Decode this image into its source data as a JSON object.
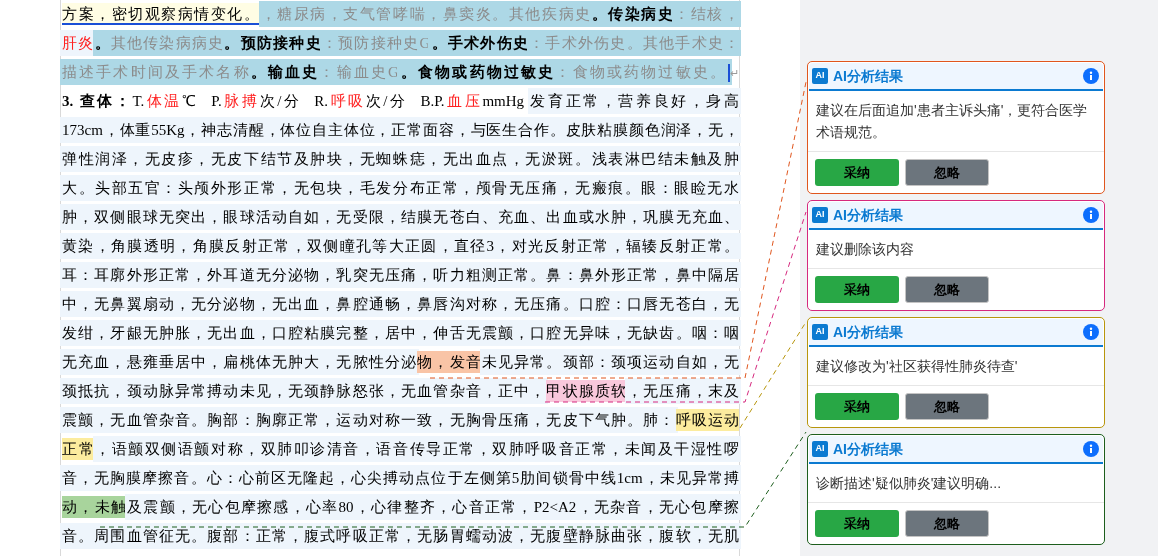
{
  "document": {
    "lines": [
      {
        "segments": [
          {
            "text": "方案，密切观察病情变化。",
            "kind": "plain",
            "selected": false,
            "shaded": false,
            "underlined": true,
            "color": "#fffde4"
          },
          {
            "text": "，糖尿病，支气管哮喘，鼻窦炎。其他疾病史",
            "kind": "field",
            "selected": true,
            "shaded": false,
            "underlined": false
          },
          {
            "text": "。传染病史",
            "kind": "bold",
            "selected": true,
            "shaded": false,
            "underlined": false
          },
          {
            "text": "：结核，",
            "kind": "field",
            "selected": true,
            "shaded": false,
            "underlined": false
          }
        ]
      },
      {
        "segments": [
          {
            "text": "肝炎",
            "kind": "value",
            "selected": false,
            "shaded": true,
            "underlined": false
          },
          {
            "text": "。",
            "kind": "bold",
            "selected": true,
            "shaded": false,
            "underlined": false
          },
          {
            "text": "其他传染病病史",
            "kind": "field",
            "selected": true,
            "shaded": false,
            "underlined": false
          },
          {
            "text": "。预防接种史",
            "kind": "bold",
            "selected": true,
            "shaded": false,
            "underlined": false
          },
          {
            "text": "：预防接种史G",
            "kind": "field",
            "selected": true,
            "shaded": false,
            "underlined": false
          },
          {
            "text": "。手术外伤史",
            "kind": "bold",
            "selected": true,
            "shaded": false,
            "underlined": false
          },
          {
            "text": "：手术外伤史。其他手术史：",
            "kind": "field",
            "selected": true,
            "shaded": false,
            "underlined": false
          }
        ]
      },
      {
        "cursor": true,
        "segments": [
          {
            "text": "描述手术时间及手术名称",
            "kind": "field",
            "selected": true,
            "shaded": false,
            "underlined": false
          },
          {
            "text": "。输血史",
            "kind": "bold",
            "selected": true,
            "shaded": false,
            "underlined": false
          },
          {
            "text": "：输血史G",
            "kind": "field",
            "selected": true,
            "shaded": false,
            "underlined": false
          },
          {
            "text": "。食物或药物过敏史",
            "kind": "bold",
            "selected": true,
            "shaded": false,
            "underlined": false
          },
          {
            "text": "：食物或药物过敏史。",
            "kind": "field",
            "selected": true,
            "shaded": false,
            "underlined": false
          },
          {
            "text": "↵",
            "kind": "pilcrow",
            "selected": false,
            "shaded": false,
            "underlined": false
          }
        ]
      },
      {
        "segments": [
          {
            "text": "3. 查体：",
            "kind": "bold",
            "selected": false,
            "shaded": false,
            "underlined": false
          },
          {
            "text": "T.",
            "kind": "plain",
            "selected": false,
            "shaded": false,
            "underlined": false
          },
          {
            "text": "体温",
            "kind": "value",
            "selected": false,
            "shaded": false,
            "underlined": false
          },
          {
            "text": "℃  P.",
            "kind": "plain",
            "selected": false,
            "shaded": false,
            "underlined": false
          },
          {
            "text": "脉搏",
            "kind": "value",
            "selected": false,
            "shaded": false,
            "underlined": false
          },
          {
            "text": "次/分  R.",
            "kind": "plain",
            "selected": false,
            "shaded": false,
            "underlined": false
          },
          {
            "text": "呼吸",
            "kind": "value",
            "selected": false,
            "shaded": false,
            "underlined": false
          },
          {
            "text": "次/分  B.P.",
            "kind": "plain",
            "selected": false,
            "shaded": false,
            "underlined": false
          },
          {
            "text": "血压",
            "kind": "value",
            "selected": false,
            "shaded": false,
            "underlined": false
          },
          {
            "text": "mmHg ",
            "kind": "plain",
            "selected": false,
            "shaded": false,
            "underlined": false
          },
          {
            "text": "发育正常，营养良好，身高",
            "kind": "plain",
            "selected": false,
            "shaded": true,
            "underlined": false
          }
        ]
      },
      {
        "segments": [
          {
            "text": "173cm，体重55Kg，神志清醒，体位自主体位，正常面容，与医生合作。皮肤粘膜颜色润泽，无，",
            "kind": "plain",
            "selected": false,
            "shaded": true,
            "underlined": false
          }
        ]
      },
      {
        "segments": [
          {
            "text": "弹性润泽，无皮疹，无皮下结节及肿块，无蜘蛛痣，无出血点，无淤斑。浅表淋巴结未触及肿",
            "kind": "plain",
            "selected": false,
            "shaded": true,
            "underlined": false
          }
        ]
      },
      {
        "segments": [
          {
            "text": "大。头部五官：头颅外形正常，无包块，毛发分布正常，颅骨无压痛，无瘢痕。眼：眼睑无水",
            "kind": "plain",
            "selected": false,
            "shaded": true,
            "underlined": false
          }
        ]
      },
      {
        "segments": [
          {
            "text": "肿，双侧眼球无突出，眼球活动自如，无受限，结膜无苍白、充血、出血或水肿，巩膜无充血、",
            "kind": "plain",
            "selected": false,
            "shaded": true,
            "underlined": false
          }
        ]
      },
      {
        "segments": [
          {
            "text": "黄染，角膜透明，角膜反射正常，双侧瞳孔等大正圆，直径3，对光反射正常，辐辏反射正常。",
            "kind": "plain",
            "selected": false,
            "shaded": true,
            "underlined": false
          }
        ]
      },
      {
        "segments": [
          {
            "text": "耳：耳廓外形正常，外耳道无分泌物，乳突无压痛，听力粗测正常。鼻：鼻外形正常，鼻中隔居",
            "kind": "plain",
            "selected": false,
            "shaded": true,
            "underlined": false
          }
        ]
      },
      {
        "segments": [
          {
            "text": "中，无鼻翼扇动，无分泌物，无出血，鼻腔通畅，鼻唇沟对称，无压痛。口腔：口唇无苍白，无",
            "kind": "plain",
            "selected": false,
            "shaded": true,
            "underlined": false
          }
        ]
      },
      {
        "segments": [
          {
            "text": "发绀，牙龈无肿胀，无出血，口腔粘膜完整，居中，伸舌无震颤，口腔无异味，无缺齿。咽：咽",
            "kind": "plain",
            "selected": false,
            "shaded": true,
            "underlined": false
          }
        ]
      },
      {
        "segments": [
          {
            "text": "无充血，悬雍垂居中，扁桃体无肿大，无脓性分泌",
            "kind": "plain",
            "selected": false,
            "shaded": true,
            "underlined": false
          },
          {
            "text": "物，发音",
            "kind": "plain",
            "selected": false,
            "shaded": false,
            "underlined": false,
            "color": "#f9c4a6"
          },
          {
            "text": "未见异常。颈部：颈项运动自如，无",
            "kind": "plain",
            "selected": false,
            "shaded": true,
            "underlined": false
          }
        ]
      },
      {
        "segments": [
          {
            "text": "颈抵抗，颈动脉异常搏动未见，无颈静脉怒张，无血管杂音，正中，",
            "kind": "plain",
            "selected": false,
            "shaded": true,
            "underlined": false
          },
          {
            "text": "甲状腺质软",
            "kind": "plain",
            "selected": false,
            "shaded": false,
            "underlined": false,
            "color": "#f9c8dc"
          },
          {
            "text": "，无压痛，末及",
            "kind": "plain",
            "selected": false,
            "shaded": true,
            "underlined": false
          }
        ]
      },
      {
        "segments": [
          {
            "text": "震颤，无血管杂音。胸部：胸廓正常，运动对称一致，无胸骨压痛，无皮下气肿。肺：",
            "kind": "plain",
            "selected": false,
            "shaded": true,
            "underlined": false
          },
          {
            "text": "呼吸运动",
            "kind": "plain",
            "selected": false,
            "shaded": false,
            "underlined": false,
            "color": "#fcec9e"
          }
        ]
      },
      {
        "segments": [
          {
            "text": "正常",
            "kind": "plain",
            "selected": false,
            "shaded": false,
            "underlined": false,
            "color": "#fcec9e"
          },
          {
            "text": "，语颤双侧语颤对称，双肺叩诊清音，语音传导正常，双肺呼吸音正常，未闻及干湿性啰",
            "kind": "plain",
            "selected": false,
            "shaded": true,
            "underlined": false
          }
        ]
      },
      {
        "segments": [
          {
            "text": "音，无胸膜摩擦音。心：心前区无隆起，心尖搏动点位于左侧第5肋间锁骨中线1cm，未见异常搏",
            "kind": "plain",
            "selected": false,
            "shaded": true,
            "underlined": false
          }
        ]
      },
      {
        "segments": [
          {
            "text": "动，未触",
            "kind": "plain",
            "selected": false,
            "shaded": false,
            "underlined": false,
            "color": "#a8d49c"
          },
          {
            "text": "及震颤，无心包摩擦感，心率80，心律整齐，心音正常，P2<A2，无杂音，无心包摩擦",
            "kind": "plain",
            "selected": false,
            "shaded": true,
            "underlined": false
          }
        ]
      },
      {
        "segments": [
          {
            "text": "音。周围血管征无。腹部：正常，腹式呼吸正常，无肠胃蠕动波，无腹壁静脉曲张，腹软，无肌",
            "kind": "plain",
            "selected": false,
            "shaded": true,
            "underlined": false
          }
        ]
      }
    ]
  },
  "suggestions": [
    {
      "color": "#e0561e",
      "badge": "AI",
      "title": "AI分析结果",
      "text": "建议在后面追加'患者主诉头痛'，更符合医学术语规范。",
      "accept": "采纳",
      "ignore": "忽略"
    },
    {
      "color": "#d6297e",
      "badge": "AI",
      "title": "AI分析结果",
      "text": "建议删除该内容",
      "accept": "采纳",
      "ignore": "忽略"
    },
    {
      "color": "#b8960c",
      "badge": "AI",
      "title": "AI分析结果",
      "text": "建议修改为'社区获得性肺炎待查'",
      "accept": "采纳",
      "ignore": "忽略"
    },
    {
      "color": "#1d5e1d",
      "badge": "AI",
      "title": "AI分析结果",
      "text": "诊断描述'疑似肺炎'建议明确...",
      "accept": "采纳",
      "ignore": "忽略"
    }
  ]
}
